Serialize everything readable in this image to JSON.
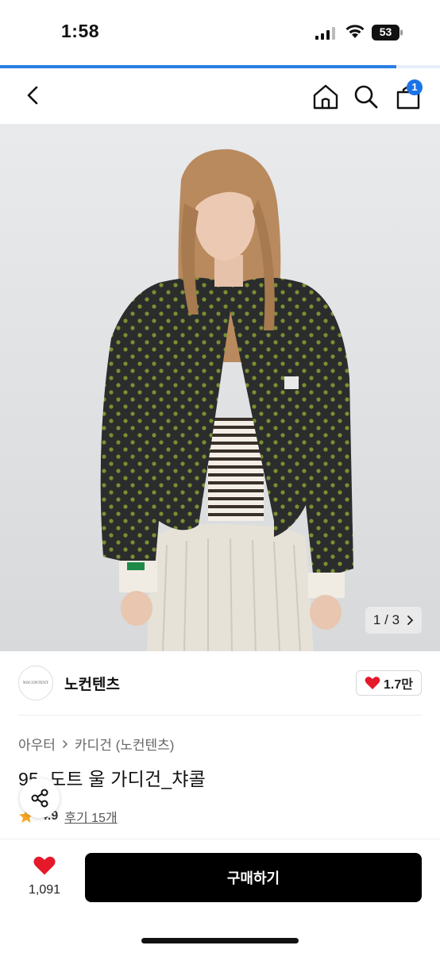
{
  "status_bar": {
    "time": "1:58",
    "battery": "53"
  },
  "page_load_progress_fraction": 0.9,
  "header": {
    "cart_count": "1"
  },
  "gallery": {
    "current": "1",
    "separator": "/",
    "total": "3"
  },
  "brand": {
    "logo_text": "NOCONTENT",
    "name": "노컨텐츠",
    "likes": "1.7만"
  },
  "category": {
    "parent": "아우터",
    "child": "카디건 (노컨텐츠)"
  },
  "product": {
    "title": "95_도트 울 가디건_챠콜"
  },
  "rating": {
    "score": "4.9",
    "reviews": "후기 15개"
  },
  "action_bar": {
    "wish_count": "1,091",
    "buy_label": "구매하기"
  },
  "colors": {
    "accent": "#1b73e8",
    "like_red": "#e5192a",
    "rating_star": "#f5a623",
    "buy_bg": "#000000"
  }
}
